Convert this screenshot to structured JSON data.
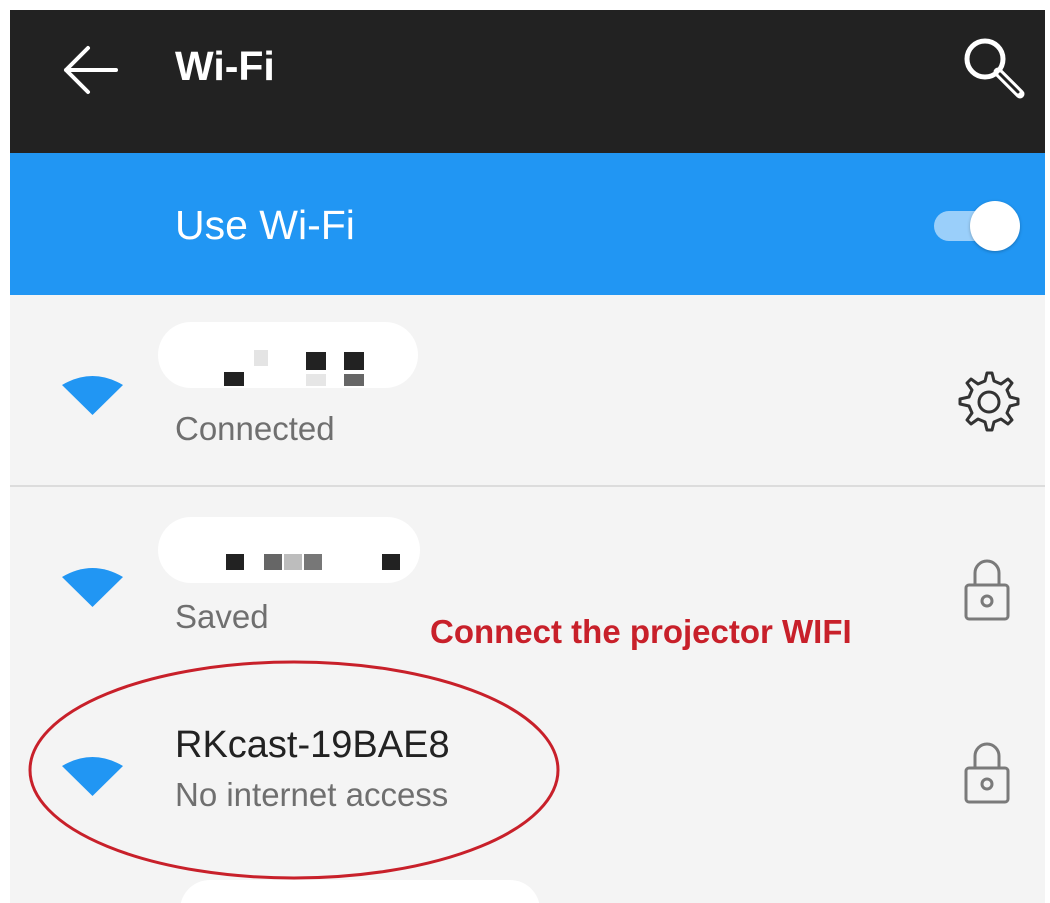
{
  "app_bar": {
    "title": "Wi-Fi",
    "back_icon": "arrow-left-icon",
    "search_icon": "search-icon"
  },
  "wifi_toggle": {
    "label": "Use Wi-Fi",
    "state": "on"
  },
  "networks": [
    {
      "ssid": "",
      "status": "Connected",
      "trailing_icon": "gear-icon",
      "ssid_redacted": true
    },
    {
      "ssid": "",
      "status": "Saved",
      "trailing_icon": "lock-icon",
      "ssid_redacted": true
    },
    {
      "ssid": "RKcast-19BAE8",
      "status": "No internet access",
      "trailing_icon": "lock-icon",
      "ssid_redacted": false
    }
  ],
  "annotation": {
    "text": "Connect the projector WIFI",
    "color": "#c8202a"
  },
  "colors": {
    "app_bar": "#222222",
    "accent": "#2196f3",
    "background": "#f4f4f4",
    "status_text": "#6f6f6f",
    "annotation_red": "#c8202a"
  }
}
